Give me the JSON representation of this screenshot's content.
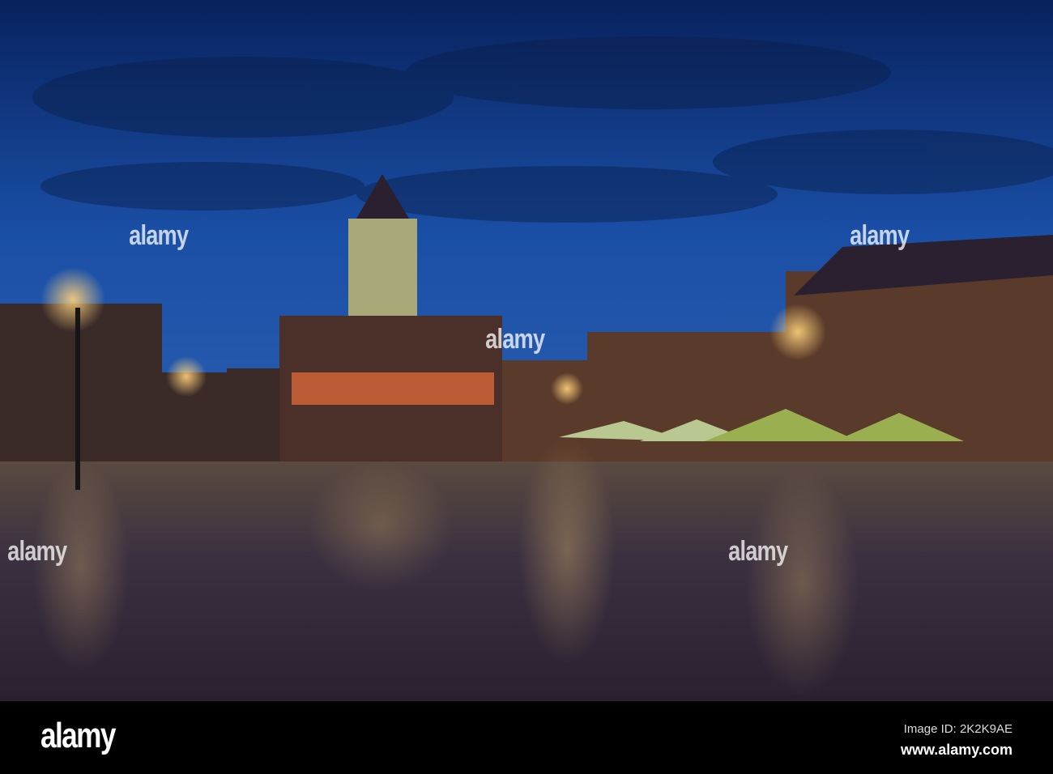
{
  "watermark": {
    "text": "alamy",
    "dot": "•"
  },
  "footer": {
    "logo": "alamy",
    "image_id": "Image ID: 2K2K9AE",
    "site": "www.alamy.com"
  },
  "colors": {
    "sky_top": "#0b2a6a",
    "sky_mid": "#1b4fa8",
    "plaza": "#3a2a20",
    "light": "#ffcf6a"
  }
}
